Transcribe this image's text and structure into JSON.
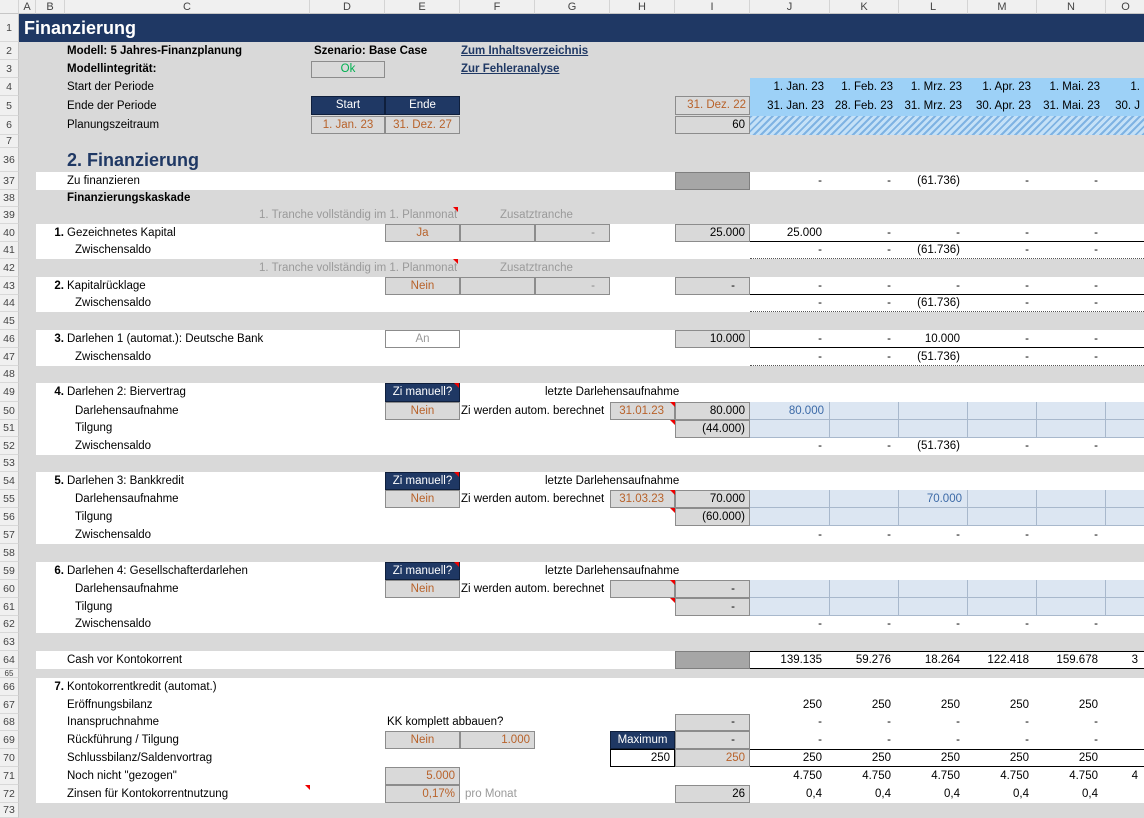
{
  "columns": [
    "A",
    "B",
    "C",
    "D",
    "E",
    "F",
    "G",
    "H",
    "I",
    "J",
    "K",
    "L",
    "M",
    "N",
    "O"
  ],
  "rows": [
    "1",
    "2",
    "3",
    "4",
    "5",
    "6",
    "7",
    "36",
    "37",
    "38",
    "39",
    "40",
    "41",
    "42",
    "43",
    "44",
    "45",
    "46",
    "47",
    "48",
    "49",
    "50",
    "51",
    "52",
    "53",
    "54",
    "55",
    "56",
    "57",
    "58",
    "59",
    "60",
    "61",
    "62",
    "63",
    "64",
    "65",
    "66",
    "67",
    "68",
    "69",
    "70",
    "71",
    "72",
    "73"
  ],
  "title": "Finanzierung",
  "header": {
    "model": "Modell: 5 Jahres-Finanzplanung",
    "scenario": "Szenario: Base Case",
    "toc_link": "Zum Inhaltsverzeichnis",
    "integrity_label": "Modellintegrität:",
    "integrity_value": "Ok",
    "error_link": "Zur Fehleranalyse",
    "start_label": "Start der Periode",
    "end_label": "Ende der Periode",
    "horizon_label": "Planungszeitraum",
    "start_head": "Start",
    "end_head": "Ende",
    "start_value": "1. Jan. 23",
    "end_value": "31. Dez. 27",
    "prior_end": "31. Dez. 22",
    "periods": "60",
    "period_starts": [
      "1. Jan. 23",
      "1. Feb. 23",
      "1. Mrz. 23",
      "1. Apr. 23",
      "1. Mai. 23",
      "1."
    ],
    "period_ends": [
      "31. Jan. 23",
      "28. Feb. 23",
      "31. Mrz. 23",
      "30. Apr. 23",
      "31. Mai. 23",
      "30. J"
    ]
  },
  "section": {
    "heading": "2. Finanzierung",
    "to_finance": {
      "label": "Zu finanzieren",
      "values": [
        "-",
        "-",
        "(61.736)",
        "-",
        "-"
      ]
    },
    "cascade_label": "Finanzierungskaskade",
    "tranche_note": "1. Tranche vollständig im 1. Planmonat ?",
    "extra_tranche": "Zusatztranche",
    "subtotal_label": "Zwischensaldo",
    "capital": {
      "num": "1.",
      "label": "Gezeichnetes Kapital",
      "flag": "Ja",
      "extra": "-",
      "total": "25.000",
      "values": [
        "25.000",
        "-",
        "-",
        "-",
        "-"
      ],
      "subtotal": [
        "-",
        "-",
        "(61.736)",
        "-",
        "-"
      ]
    },
    "reserve": {
      "num": "2.",
      "label": "Kapitalrücklage",
      "flag": "Nein",
      "extra": "-",
      "total": "-",
      "values": [
        "-",
        "-",
        "-",
        "-",
        "-"
      ],
      "subtotal": [
        "-",
        "-",
        "(61.736)",
        "-",
        "-"
      ]
    },
    "loan1": {
      "num": "3.",
      "label": "Darlehen 1 (automat.): Deutsche Bank",
      "flag": "An",
      "total": "10.000",
      "values": [
        "-",
        "-",
        "10.000",
        "-",
        "-"
      ],
      "subtotal": [
        "-",
        "-",
        "(51.736)",
        "-",
        "-"
      ]
    },
    "manual_interest": "Zi manuell?",
    "last_drawdown": "letzte Darlehensaufnahme",
    "auto_interest": "Zi werden autom. berechnet",
    "drawdown_label": "Darlehensaufnahme",
    "repayment_label": "Tilgung",
    "loans": [
      {
        "num": "4.",
        "label": "Darlehen 2: Biervertrag",
        "flag": "Nein",
        "date": "31.01.23",
        "draw_total": "80.000",
        "repay_total": "(44.000)",
        "draw_values": [
          "80.000",
          "",
          "",
          "",
          ""
        ],
        "subtotal": [
          "-",
          "-",
          "(51.736)",
          "-",
          "-"
        ]
      },
      {
        "num": "5.",
        "label": "Darlehen 3: Bankkredit",
        "flag": "Nein",
        "date": "31.03.23",
        "draw_total": "70.000",
        "repay_total": "(60.000)",
        "draw_values": [
          "",
          "",
          "70.000",
          "",
          ""
        ],
        "subtotal": [
          "-",
          "-",
          "-",
          "-",
          "-"
        ]
      },
      {
        "num": "6.",
        "label": "Darlehen 4: Gesellschafterdarlehen",
        "flag": "Nein",
        "date": "",
        "draw_total": "-",
        "repay_total": "-",
        "draw_values": [
          "",
          "",
          "",
          "",
          ""
        ],
        "subtotal": [
          "-",
          "-",
          "-",
          "-",
          "-"
        ]
      }
    ],
    "cash_before": {
      "label": "Cash vor Kontokorrent",
      "values": [
        "139.135",
        "59.276",
        "18.264",
        "122.418",
        "159.678",
        "3"
      ]
    },
    "overdraft": {
      "num": "7.",
      "label": "Kontokorrentkredit (automat.)",
      "opening": {
        "label": "Eröffnungsbilanz",
        "values": [
          "250",
          "250",
          "250",
          "250",
          "250"
        ]
      },
      "usage": {
        "label": "Inanspruchnahme",
        "question": "KK komplett abbauen?",
        "total": "-",
        "values": [
          "-",
          "-",
          "-",
          "-",
          "-"
        ]
      },
      "repay": {
        "label": "Rückführung / Tilgung",
        "flag": "Nein",
        "amount": "1.000",
        "max_head": "Maximum",
        "total": "-",
        "values": [
          "-",
          "-",
          "-",
          "-",
          "-"
        ]
      },
      "closing": {
        "label": "Schlussbilanz/Saldenvortrag",
        "max": "250",
        "total": "250",
        "values": [
          "250",
          "250",
          "250",
          "250",
          "250"
        ]
      },
      "not_drawn": {
        "label": "Noch nicht \"gezogen\"",
        "limit": "5.000",
        "values": [
          "4.750",
          "4.750",
          "4.750",
          "4.750",
          "4.750",
          "4"
        ]
      },
      "interest": {
        "label": "Zinsen für Kontokorrentnutzung",
        "rate": "0,17%",
        "unit": "pro Monat",
        "total": "26",
        "values": [
          "0,4",
          "0,4",
          "0,4",
          "0,4",
          "0,4"
        ]
      }
    }
  },
  "colors": {
    "navy": "#1f3864",
    "input_text": "#b8622a",
    "ok_green": "#00b050",
    "period_blue": "#9dd1f7",
    "input_area": "#dce6f2",
    "band_gray": "#d9d9d9"
  }
}
